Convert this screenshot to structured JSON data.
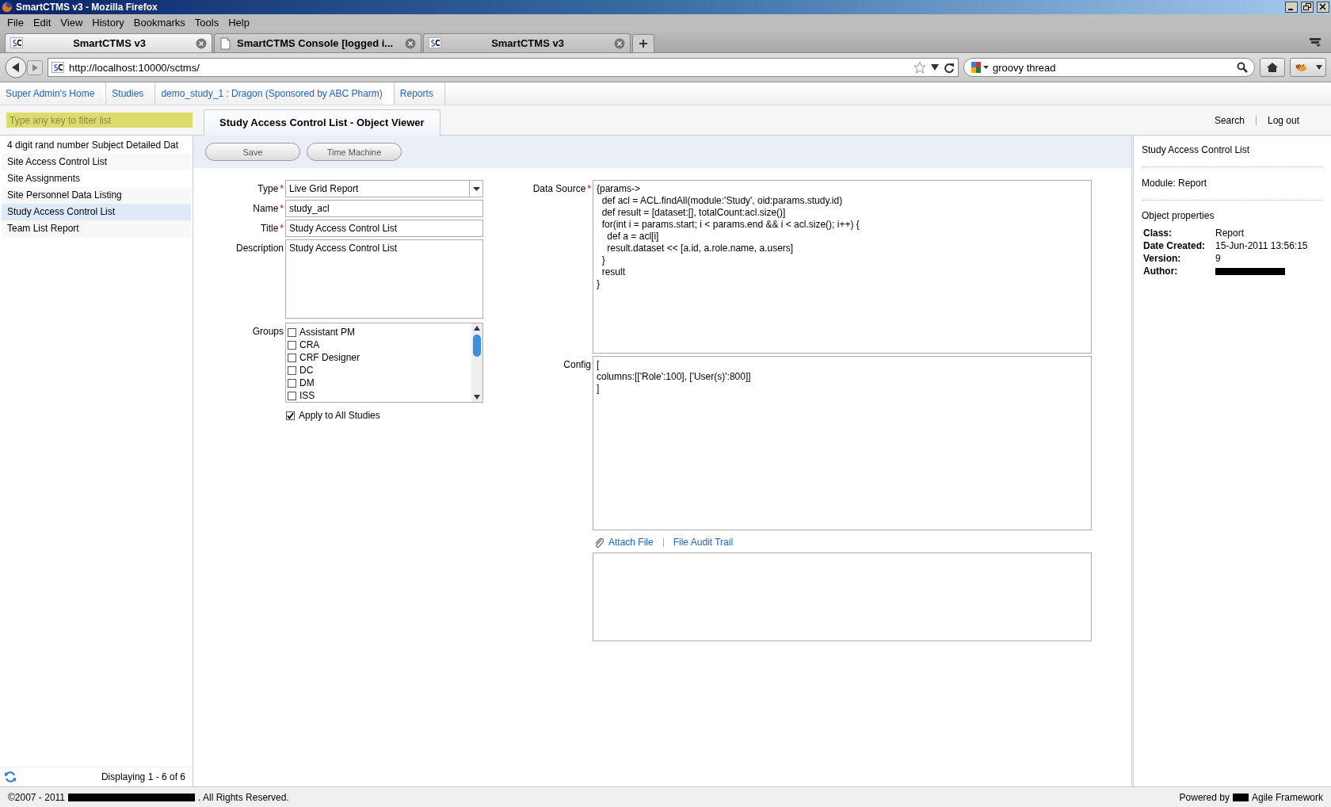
{
  "window": {
    "title": "SmartCTMS v3 - Mozilla Firefox"
  },
  "menu": [
    "File",
    "Edit",
    "View",
    "History",
    "Bookmarks",
    "Tools",
    "Help"
  ],
  "browser_tabs": [
    {
      "label": "SmartCTMS v3",
      "selected": true,
      "kind": "sc"
    },
    {
      "label": "SmartCTMS Console [logged i...",
      "selected": false,
      "kind": "page"
    },
    {
      "label": "SmartCTMS v3",
      "selected": false,
      "kind": "sc"
    }
  ],
  "address": {
    "url": "http://localhost:10000/sctms/"
  },
  "search_box": {
    "value": "groovy thread"
  },
  "breadcrumbs": [
    "Super Admin's Home",
    "Studies",
    "demo_study_1 : Dragon (Sponsored by ABC Pharm)",
    "Reports"
  ],
  "filter": {
    "placeholder": "Type any key to filter list"
  },
  "report_list": {
    "items": [
      {
        "label": "4 digit rand number Subject Detailed Dat",
        "selected": false
      },
      {
        "label": "Site Access Control List",
        "selected": false
      },
      {
        "label": "Site Assignments",
        "selected": false
      },
      {
        "label": "Site Personnel Data Listing",
        "selected": false
      },
      {
        "label": "Study Access Control List",
        "selected": true
      },
      {
        "label": "Team List Report",
        "selected": false
      }
    ],
    "status": "Displaying 1 - 6 of 6"
  },
  "viewer_tab": {
    "label": "Study Access Control List - Object Viewer"
  },
  "header_links": [
    "Search",
    "Log out"
  ],
  "toolbar": [
    "Save",
    "Time Machine"
  ],
  "form_fields": [
    {
      "kind": "select",
      "label": "Type",
      "marker": "*",
      "value": "Live Grid Report"
    },
    {
      "kind": "text",
      "label": "Name",
      "marker": "*",
      "value": "study_acl"
    },
    {
      "kind": "text",
      "label": "Title",
      "marker": "*",
      "value": "Study Access Control List"
    },
    {
      "kind": "textarea",
      "label": "Description",
      "value": "Study Access Control List"
    },
    {
      "kind": "checklist",
      "label": "Groups",
      "options": [
        {
          "label": "Assistant PM",
          "checked": false
        },
        {
          "label": "CRA",
          "checked": false
        },
        {
          "label": "CRF Designer",
          "checked": false
        },
        {
          "label": "DC",
          "checked": false
        },
        {
          "label": "DM",
          "checked": false
        },
        {
          "label": "ISS",
          "checked": false
        }
      ]
    }
  ],
  "apply_all": {
    "label": "Apply to All Studies",
    "checked": true
  },
  "code_fields": [
    {
      "label": "Data Source",
      "marker": "*",
      "value": "{params->\n  def acl = ACL.findAll(module:'Study', oid:params.study.id)\n  def result = [dataset:[], totalCount:acl.size()]\n  for(int i = params.start; i < params.end && i < acl.size(); i++) {\n    def a = acl[i]\n    result.dataset << [a.id, a.role.name, a.users]\n  }\n  result\n}"
    },
    {
      "label": "Config",
      "value": "[\ncolumns:[['Role':100], ['User(s)':800]]\n]"
    }
  ],
  "attachments": {
    "links": [
      "Attach File",
      "File Audit Trail"
    ]
  },
  "properties_panel": {
    "title": "Study Access Control List",
    "module": "Module: Report",
    "heading": "Object properties",
    "rows": [
      {
        "label": "Class:",
        "value": "Report"
      },
      {
        "label": "Date Created:",
        "value": "15-Jun-2011 13:56:15"
      },
      {
        "label": "Version:",
        "value": "9"
      },
      {
        "label": "Author:",
        "redacted": true
      }
    ]
  },
  "footer": {
    "left": [
      {
        "text": "©2007 - 2011"
      },
      {
        "redacted": true
      },
      {
        "text": ". All Rights Reserved."
      }
    ],
    "right": [
      {
        "text": "Powered by"
      },
      {
        "redacted": true
      },
      {
        "text": "Agile Framework"
      }
    ]
  }
}
